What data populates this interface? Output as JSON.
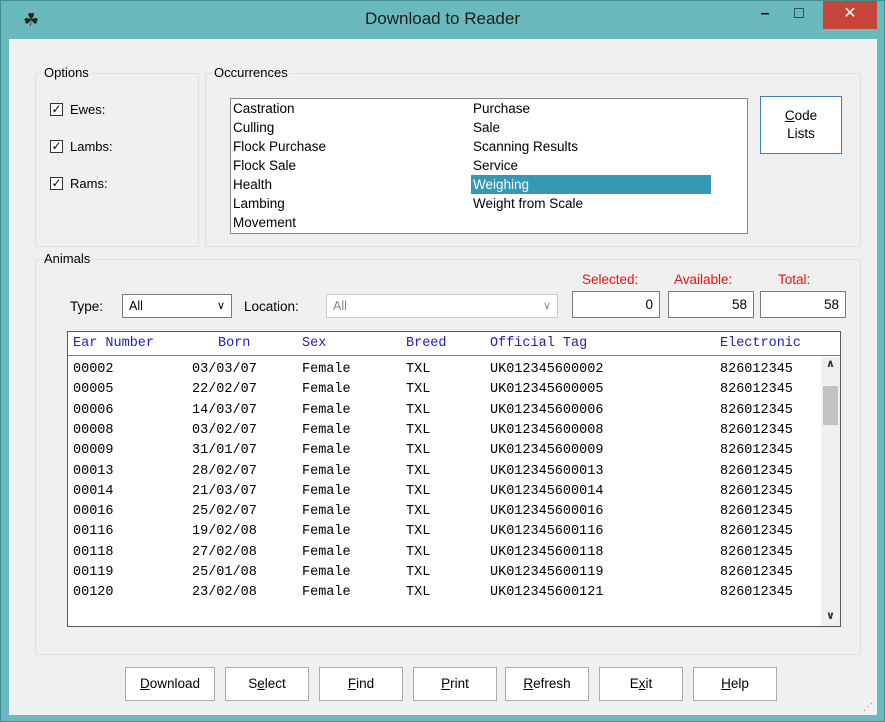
{
  "window": {
    "title": "Download to Reader",
    "minimize_glyph": "–",
    "maximize_glyph": "□",
    "close_glyph": "✕",
    "icon": "sheep-app-icon"
  },
  "options": {
    "label": "Options",
    "items": [
      {
        "label": "Ewes:",
        "checked": true
      },
      {
        "label": "Lambs:",
        "checked": true
      },
      {
        "label": "Rams:",
        "checked": true
      }
    ]
  },
  "occurrences": {
    "label": "Occurrences",
    "items": [
      "Castration",
      "Culling",
      "Flock Purchase",
      "Flock Sale",
      "Health",
      "Lambing",
      "Movement",
      "Purchase",
      "Sale",
      "Scanning Results",
      "Service",
      "Weighing",
      "Weight from Scale"
    ],
    "selected": "Weighing",
    "code_lists_line1": "Code",
    "code_lists_line2": "Lists"
  },
  "animals": {
    "label": "Animals",
    "type_label": "Type:",
    "type_value": "All",
    "location_label": "Location:",
    "location_value": "All",
    "selected_label": "Selected:",
    "selected_value": "0",
    "available_label": "Available:",
    "available_value": "58",
    "total_label": "Total:",
    "total_value": "58",
    "columns": [
      "Ear Number",
      "Born",
      "Sex",
      "Breed",
      "Official Tag",
      "Electronic"
    ],
    "rows": [
      [
        "00002",
        "03/03/07",
        "Female",
        "TXL",
        "UK012345600002",
        "826012345"
      ],
      [
        "00005",
        "22/02/07",
        "Female",
        "TXL",
        "UK012345600005",
        "826012345"
      ],
      [
        "00006",
        "14/03/07",
        "Female",
        "TXL",
        "UK012345600006",
        "826012345"
      ],
      [
        "00008",
        "03/02/07",
        "Female",
        "TXL",
        "UK012345600008",
        "826012345"
      ],
      [
        "00009",
        "31/01/07",
        "Female",
        "TXL",
        "UK012345600009",
        "826012345"
      ],
      [
        "00013",
        "28/02/07",
        "Female",
        "TXL",
        "UK012345600013",
        "826012345"
      ],
      [
        "00014",
        "21/03/07",
        "Female",
        "TXL",
        "UK012345600014",
        "826012345"
      ],
      [
        "00016",
        "25/02/07",
        "Female",
        "TXL",
        "UK012345600016",
        "826012345"
      ],
      [
        "00116",
        "19/02/08",
        "Female",
        "TXL",
        "UK012345600116",
        "826012345"
      ],
      [
        "00118",
        "27/02/08",
        "Female",
        "TXL",
        "UK012345600118",
        "826012345"
      ],
      [
        "00119",
        "25/01/08",
        "Female",
        "TXL",
        "UK012345600119",
        "826012345"
      ],
      [
        "00120",
        "23/02/08",
        "Female",
        "TXL",
        "UK012345600121",
        "826012345"
      ]
    ]
  },
  "buttons": [
    {
      "name": "download-button",
      "label": "Download",
      "ul": "D"
    },
    {
      "name": "select-button",
      "label": "Select",
      "ul": "e"
    },
    {
      "name": "find-button",
      "label": "Find",
      "ul": "F"
    },
    {
      "name": "print-button",
      "label": "Print",
      "ul": "P"
    },
    {
      "name": "refresh-button",
      "label": "Refresh",
      "ul": "R"
    },
    {
      "name": "exit-button",
      "label": "Exit",
      "ul": "x"
    },
    {
      "name": "help-button",
      "label": "Help",
      "ul": "H"
    }
  ],
  "colors": {
    "title_bar": "#6ab9bd",
    "close_button": "#c7443b",
    "selection": "#3399b5",
    "header_text": "#1f1fb0",
    "count_labels": "#e11111"
  }
}
